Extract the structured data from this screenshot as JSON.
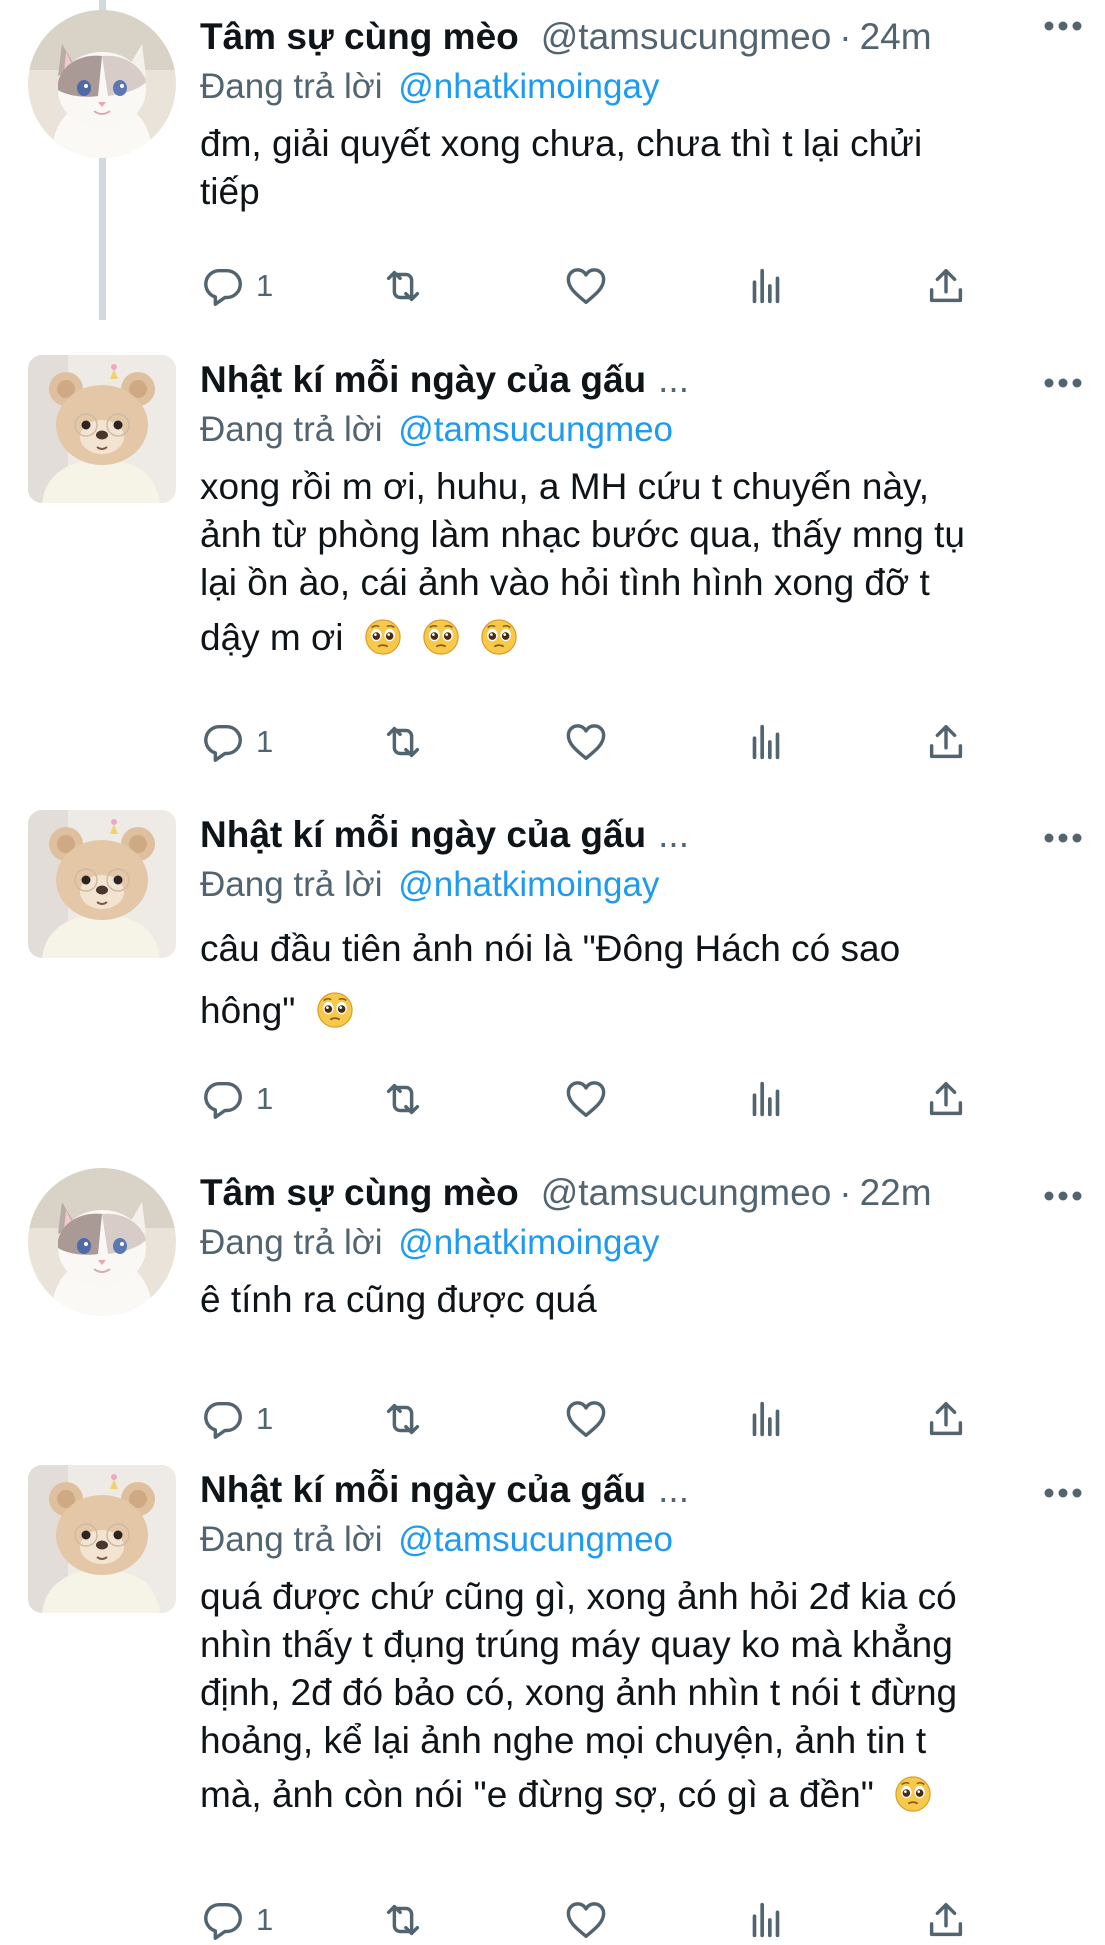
{
  "colors": {
    "text": "#0f1419",
    "muted": "#536471",
    "link": "#1d9bf0",
    "thread_line": "#cfd9de"
  },
  "reply_prefix": "Đang trả lời",
  "tweets": [
    {
      "name": "Tâm sự cùng mèo",
      "truncated": "",
      "handle": "@tamsucungmeo",
      "separator": "·",
      "time": "24m",
      "reply_to": "@nhatkimoingay",
      "lines": [
        "đm, giải quyết xong chưa, chưa thì t lại chửi",
        "tiếp"
      ],
      "reply_count": "1",
      "avatar_icon": "cat-avatar-icon"
    },
    {
      "name": "Nhật kí mỗi ngày của gấu",
      "truncated": "...",
      "handle": "",
      "separator": "",
      "time": "",
      "reply_to": "@tamsucungmeo",
      "lines": [
        "xong rồi m ơi, huhu, a MH cứu t chuyến này,",
        "ảnh từ phòng làm nhạc bước qua, thấy mng tụ",
        "lại ồn ào, cái ảnh vào hỏi tình hình xong đỡ t",
        "dậy m ơi"
      ],
      "emoji_count": 3,
      "reply_count": "1",
      "avatar_icon": "bear-avatar-icon"
    },
    {
      "name": "Nhật kí mỗi ngày của gấu",
      "truncated": "...",
      "handle": "",
      "separator": "",
      "time": "",
      "reply_to": "@nhatkimoingay",
      "lines": [
        "câu đầu tiên ảnh nói là \"Đông Hách có sao",
        "hông\""
      ],
      "emoji_count": 1,
      "reply_count": "1",
      "avatar_icon": "bear-avatar-icon"
    },
    {
      "name": "Tâm sự cùng mèo",
      "truncated": "",
      "handle": "@tamsucungmeo",
      "separator": "·",
      "time": "22m",
      "reply_to": "@nhatkimoingay",
      "lines": [
        "ê tính ra cũng được quá"
      ],
      "reply_count": "1",
      "avatar_icon": "cat-avatar-icon"
    },
    {
      "name": "Nhật kí mỗi ngày của gấu",
      "truncated": "...",
      "handle": "",
      "separator": "",
      "time": "",
      "reply_to": "@tamsucungmeo",
      "lines": [
        "quá được chứ cũng gì, xong ảnh hỏi 2đ kia có",
        "nhìn thấy t đụng trúng máy quay ko mà khẳng",
        "định, 2đ đó bảo có, xong ảnh nhìn t nói t đừng",
        "hoảng, kể lại ảnh nghe mọi chuyện, ảnh tin t",
        "mà, ảnh còn nói \"e đừng sợ, có gì a đền\""
      ],
      "emoji_count": 1,
      "reply_count": "1",
      "avatar_icon": "bear-avatar-icon"
    }
  ]
}
